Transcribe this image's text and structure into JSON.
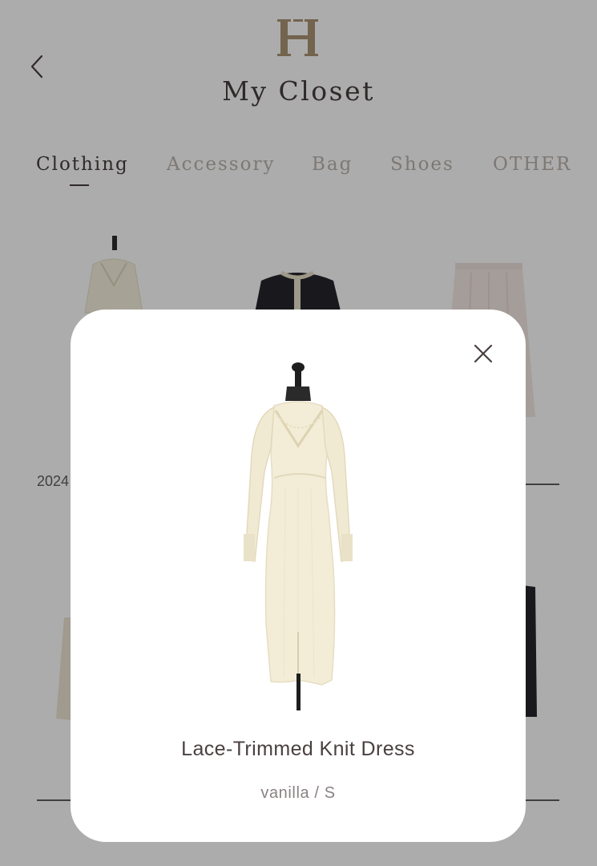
{
  "header": {
    "logo_letter": "H",
    "title": "My Closet"
  },
  "tabs": [
    {
      "label": "Clothing",
      "active": true
    },
    {
      "label": "Accessory",
      "active": false
    },
    {
      "label": "Bag",
      "active": false
    },
    {
      "label": "Shoes",
      "active": false
    },
    {
      "label": "OTHER",
      "active": false
    }
  ],
  "grid": {
    "year_label": "2024"
  },
  "modal": {
    "item_name": "Lace-Trimmed Knit Dress",
    "item_variant": "vanilla / S"
  },
  "colors": {
    "accent_gold": "#a48d6c",
    "text_dark": "#3e3434",
    "tab_inactive": "#b3aca6",
    "dress_cream": "#f3edd7"
  }
}
